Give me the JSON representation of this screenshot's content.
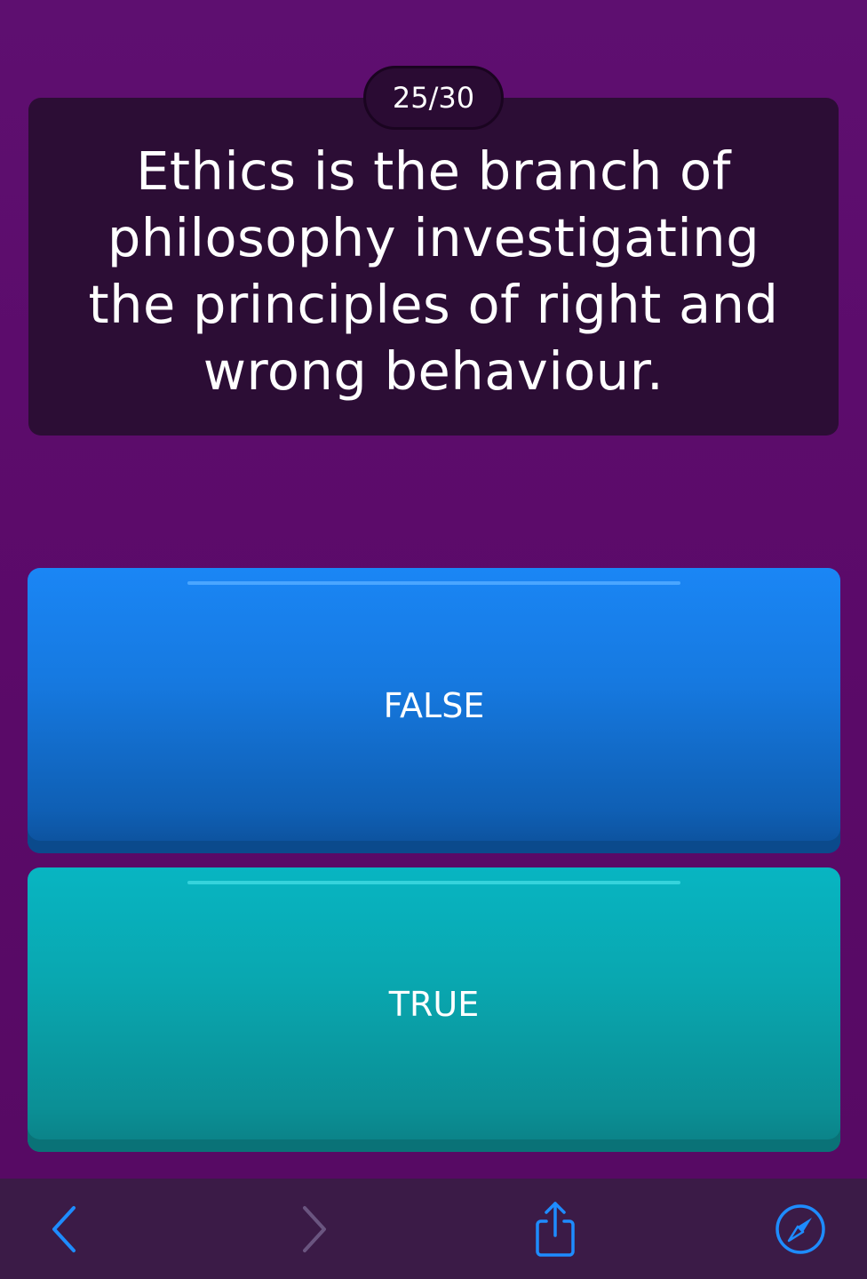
{
  "quiz": {
    "counter": "25/30",
    "question": "Ethics is the branch of philosophy investigating the principles of right and wrong behaviour.",
    "answers": [
      {
        "label": "FALSE",
        "color": "#1a86f5"
      },
      {
        "label": "TRUE",
        "color": "#08b5c2"
      }
    ]
  },
  "toolbar": {
    "icons": [
      "back-arrow-icon",
      "forward-arrow-icon",
      "share-icon",
      "compass-icon"
    ],
    "accent": "#1e8cff"
  },
  "colors": {
    "background": "#5c0b6b",
    "card": "#2c0d35"
  }
}
